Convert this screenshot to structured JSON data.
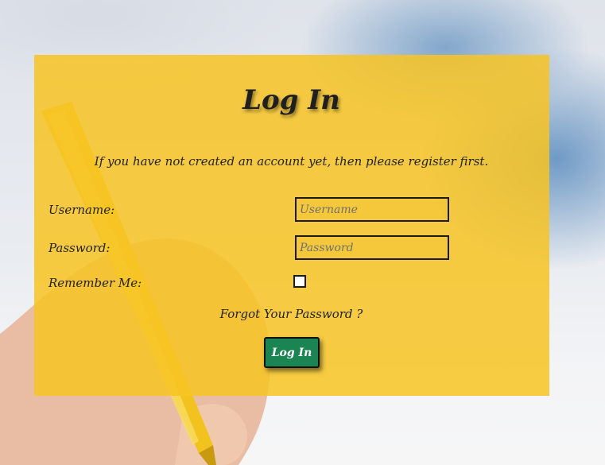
{
  "login": {
    "title": "Log In",
    "subtitle": "If you have not created an account yet, then please register first.",
    "username_label": "Username:",
    "username_placeholder": "Username",
    "password_label": "Password:",
    "password_placeholder": "Password",
    "remember_label": "Remember Me:",
    "remember_checked": false,
    "forgot_link": "Forgot Your Password ?",
    "submit_label": "Log In"
  },
  "colors": {
    "panel": "#f7c424",
    "button": "#1a8552",
    "text": "#222222"
  },
  "icons": {
    "background": "hand-writing-with-pen-photo"
  }
}
